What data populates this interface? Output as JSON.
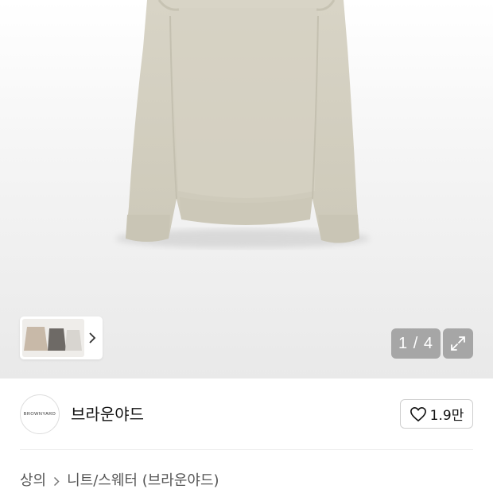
{
  "product": {
    "image_icon": "sweater-photo",
    "thumbnail_icon": "sweater-thumbnails",
    "image_counter": "1 / 4",
    "thumbnail_colors": [
      "#c8b9a8",
      "#6e6a66",
      "#d8d5d0"
    ],
    "sweater_color": "#d3cfbf"
  },
  "brand": {
    "logo_text": "BROWNYARD",
    "name": "브라운야드",
    "likes": "1.9만"
  },
  "breadcrumb": {
    "items": [
      "상의",
      "니트/스웨터 (브라운야드)"
    ]
  }
}
